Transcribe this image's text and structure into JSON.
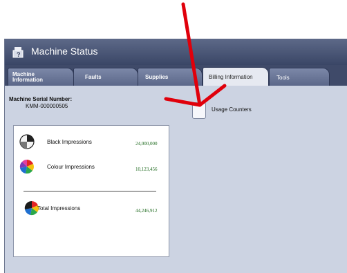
{
  "window": {
    "title": "Machine Status",
    "title_icon": "machine-status-icon"
  },
  "tabs": [
    {
      "label": "Machine Information",
      "line1": "Machine",
      "line2": "Information",
      "active": false
    },
    {
      "label": "Faults",
      "active": false
    },
    {
      "label": "Supplies",
      "active": false
    },
    {
      "label": "Billing Information",
      "active": true
    },
    {
      "label": "Tools",
      "active": false
    }
  ],
  "serial": {
    "label": "Machine Serial Number:",
    "value": "KMM-000000505"
  },
  "usage_counters": {
    "label": "Usage Counters"
  },
  "impressions": [
    {
      "label": "Black Impressions",
      "value": "24,000,000",
      "icon": "black-impressions-icon"
    },
    {
      "label": "Colour Impressions",
      "value": "10,123,456",
      "icon": "colour-impressions-icon"
    }
  ],
  "total": {
    "label": "Total Impressions",
    "value": "44,246,912",
    "icon": "total-impressions-icon"
  },
  "colors": {
    "titlebar": "#3a4666",
    "tab": "#5b6789",
    "content": "#ccd3e2",
    "value_text": "#1f6a1f",
    "annotation_arrow": "#e0000b"
  }
}
